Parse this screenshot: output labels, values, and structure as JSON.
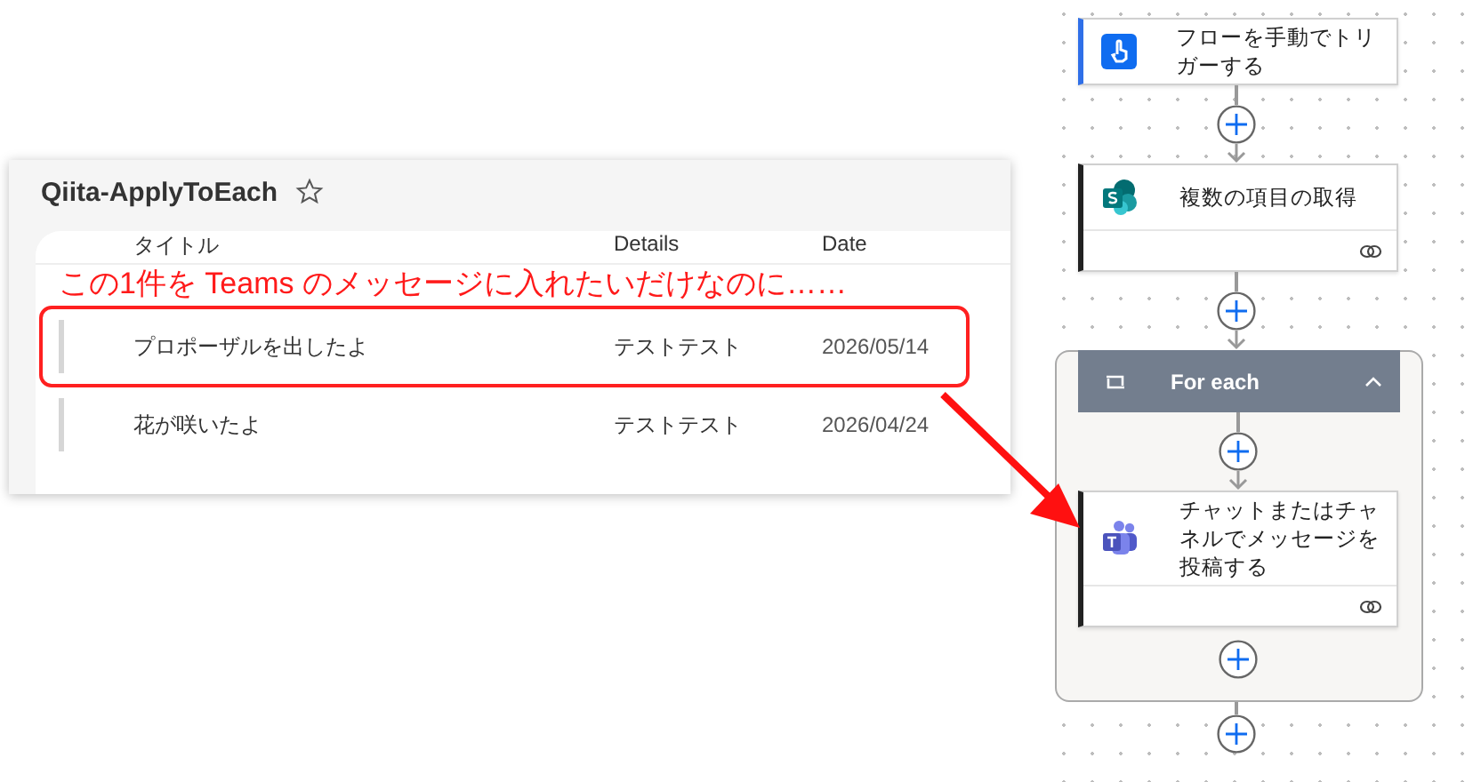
{
  "list": {
    "title": "Qiita-ApplyToEach",
    "favorite": false,
    "columns": [
      "タイトル",
      "Details",
      "Date"
    ],
    "rows": [
      {
        "title": "プロポーザルを出したよ",
        "details": "テストテスト",
        "date": "2026/05/14"
      },
      {
        "title": "花が咲いたよ",
        "details": "テストテスト",
        "date": "2026/04/24"
      }
    ]
  },
  "annotation": {
    "text": "この1件を Teams のメッセージに入れたいだけなのに……"
  },
  "flow": {
    "steps": [
      {
        "kind": "trigger",
        "title": "フローを手動でトリガーする"
      },
      {
        "kind": "getitems",
        "title": "複数の項目の取得"
      },
      {
        "kind": "foreach",
        "title": "For each",
        "expanded": true,
        "children": [
          {
            "kind": "post",
            "title": "チャットまたはチャネルでメッセージを投稿する"
          }
        ]
      }
    ]
  }
}
